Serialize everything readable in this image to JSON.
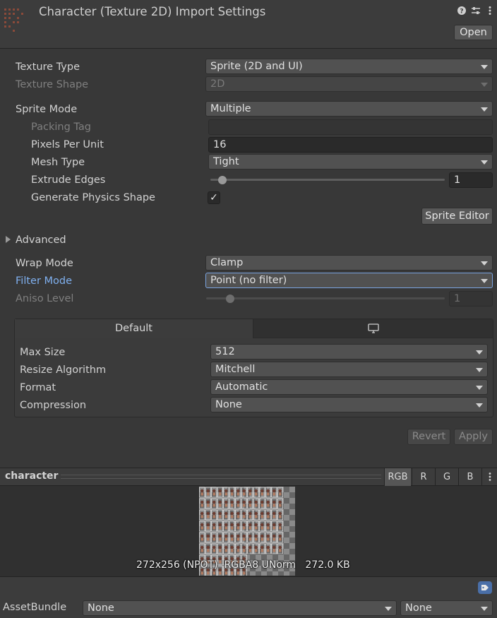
{
  "header": {
    "title": "Character (Texture 2D) Import Settings",
    "open_label": "Open",
    "icons": [
      "help-icon",
      "preset-icon",
      "more-icon"
    ]
  },
  "settings": {
    "texture_type": {
      "label": "Texture Type",
      "value": "Sprite (2D and UI)"
    },
    "texture_shape": {
      "label": "Texture Shape",
      "value": "2D"
    },
    "sprite_mode": {
      "label": "Sprite Mode",
      "value": "Multiple"
    },
    "packing_tag": {
      "label": "Packing Tag",
      "value": ""
    },
    "pixels_per_unit": {
      "label": "Pixels Per Unit",
      "value": "16"
    },
    "mesh_type": {
      "label": "Mesh Type",
      "value": "Tight"
    },
    "extrude_edges": {
      "label": "Extrude Edges",
      "value": "1",
      "slider_fraction": 0.05
    },
    "generate_physics_shape": {
      "label": "Generate Physics Shape",
      "checked": true,
      "check_glyph": "✓"
    },
    "sprite_editor_label": "Sprite Editor",
    "advanced_label": "Advanced",
    "wrap_mode": {
      "label": "Wrap Mode",
      "value": "Clamp"
    },
    "filter_mode": {
      "label": "Filter Mode",
      "value": "Point (no filter)"
    },
    "aniso_level": {
      "label": "Aniso Level",
      "value": "1",
      "slider_fraction": 0.1
    }
  },
  "platform": {
    "tabs": [
      {
        "label": "Default",
        "active": true
      },
      {
        "label": "",
        "icon": "monitor-icon",
        "active": false
      }
    ],
    "max_size": {
      "label": "Max Size",
      "value": "512"
    },
    "resize_algorithm": {
      "label": "Resize Algorithm",
      "value": "Mitchell"
    },
    "format": {
      "label": "Format",
      "value": "Automatic"
    },
    "compression": {
      "label": "Compression",
      "value": "None"
    }
  },
  "actions": {
    "revert_label": "Revert",
    "apply_label": "Apply"
  },
  "preview": {
    "name": "character",
    "channels": [
      "RGB",
      "R",
      "G",
      "B"
    ],
    "active_channel": "RGB",
    "info": "272x256 (NPOT)  RGBA8 UNorm   272.0 KB"
  },
  "asset_bundle": {
    "label": "AssetBundle",
    "name_value": "None",
    "variant_value": "None"
  },
  "colors": {
    "background": "#383838",
    "accent_blue": "#7fb0ef",
    "focus_border": "#7aa4e0"
  }
}
